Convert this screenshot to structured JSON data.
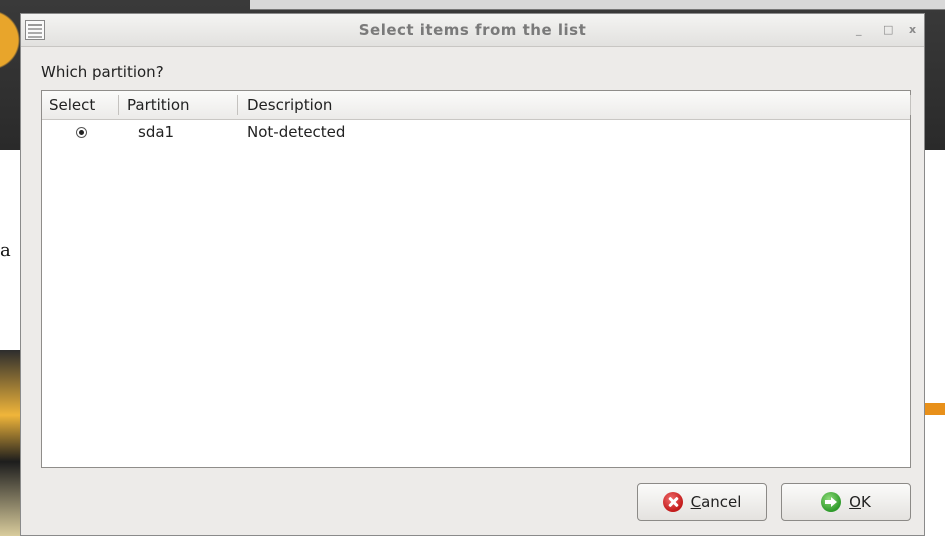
{
  "window": {
    "title": "Select items from the list",
    "controls": {
      "minimize": "_",
      "maximize": "□",
      "close": "x"
    }
  },
  "background": {
    "fragment_letter": "a"
  },
  "dialog": {
    "question": "Which partition?",
    "list": {
      "columns": [
        "Select",
        "Partition",
        "Description"
      ],
      "rows": [
        {
          "selected": true,
          "partition": "sda1",
          "description": "Not-detected"
        }
      ]
    }
  },
  "buttons": {
    "cancel": {
      "mnemonic": "C",
      "rest": "ancel",
      "icon": "cancel-icon",
      "color": "#c21a1a"
    },
    "ok": {
      "mnemonic": "O",
      "rest": "K",
      "icon": "ok-arrow-icon",
      "color": "#2e9a2a"
    }
  }
}
